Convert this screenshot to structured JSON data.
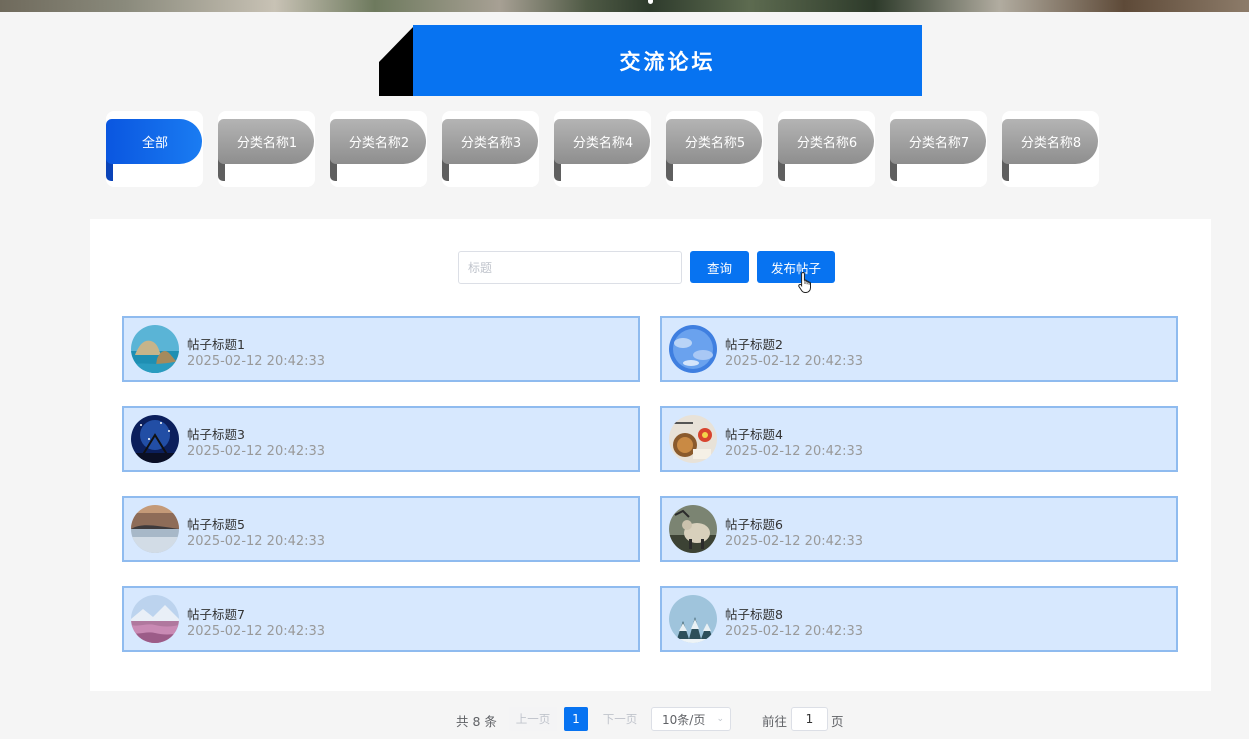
{
  "header": {
    "title": "交流论坛"
  },
  "categories": [
    {
      "label": "全部",
      "active": true
    },
    {
      "label": "分类名称1",
      "active": false
    },
    {
      "label": "分类名称2",
      "active": false
    },
    {
      "label": "分类名称3",
      "active": false
    },
    {
      "label": "分类名称4",
      "active": false
    },
    {
      "label": "分类名称5",
      "active": false
    },
    {
      "label": "分类名称6",
      "active": false
    },
    {
      "label": "分类名称7",
      "active": false
    },
    {
      "label": "分类名称8",
      "active": false
    }
  ],
  "search": {
    "placeholder": "标题",
    "value": "",
    "query_label": "查询",
    "post_label": "发布帖子"
  },
  "posts": [
    {
      "title": "帖子标题1",
      "time": "2025-02-12 20:42:33",
      "thumb": "coastal-rocks"
    },
    {
      "title": "帖子标题2",
      "time": "2025-02-12 20:42:33",
      "thumb": "blue-sky"
    },
    {
      "title": "帖子标题3",
      "time": "2025-02-12 20:42:33",
      "thumb": "starry-night"
    },
    {
      "title": "帖子标题4",
      "time": "2025-02-12 20:42:33",
      "thumb": "food-plate"
    },
    {
      "title": "帖子标题5",
      "time": "2025-02-12 20:42:33",
      "thumb": "sunset-lake"
    },
    {
      "title": "帖子标题6",
      "time": "2025-02-12 20:42:33",
      "thumb": "animals"
    },
    {
      "title": "帖子标题7",
      "time": "2025-02-12 20:42:33",
      "thumb": "flower-field"
    },
    {
      "title": "帖子标题8",
      "time": "2025-02-12 20:42:33",
      "thumb": "snowy-trees"
    }
  ],
  "pagination": {
    "total_text": "共 8 条",
    "prev_label": "上一页",
    "current_page": "1",
    "next_label": "下一页",
    "page_size": "10条/页",
    "goto_label": "前往",
    "goto_value": "1",
    "page_suffix": "页"
  },
  "colors": {
    "accent": "#0773f1",
    "post_bg": "#d7e8fe",
    "post_border": "#8fbbef"
  }
}
